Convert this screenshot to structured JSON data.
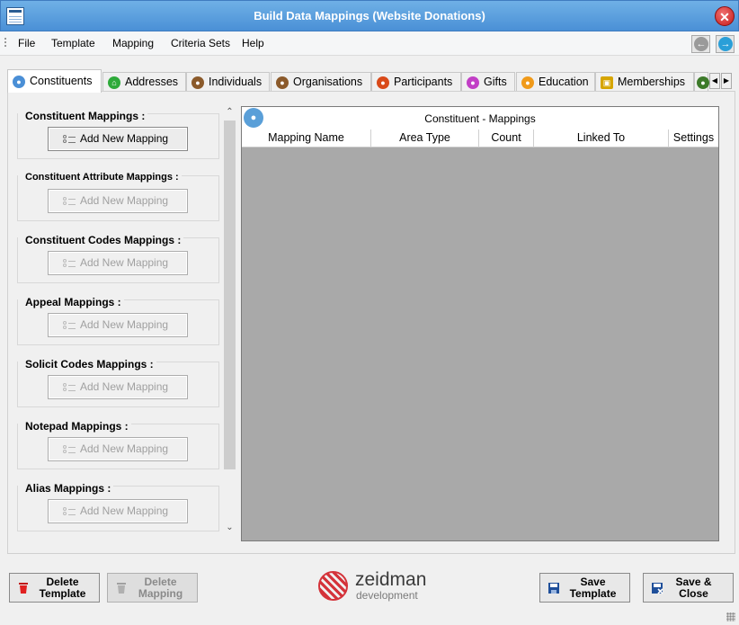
{
  "window": {
    "title": "Build Data Mappings (Website Donations)",
    "close_symbol": "✕"
  },
  "menu": {
    "items": [
      "File",
      "Template",
      "Mapping",
      "Criteria Sets",
      "Help"
    ],
    "back_icon": "back-arrow-icon",
    "forward_icon": "forward-arrow-icon"
  },
  "tabs": [
    {
      "label": "Constituents",
      "icon": "constituent-icon",
      "color": "#4a8fd6",
      "active": true
    },
    {
      "label": "Addresses",
      "icon": "house-icon",
      "color": "#2eaa3a"
    },
    {
      "label": "Individuals",
      "icon": "individuals-icon",
      "color": "#8b5a2b"
    },
    {
      "label": "Organisations",
      "icon": "organisation-icon",
      "color": "#8b5a2b"
    },
    {
      "label": "Participants",
      "icon": "participants-icon",
      "color": "#d94a1a"
    },
    {
      "label": "Gifts",
      "icon": "gift-icon",
      "color": "#c23fc6"
    },
    {
      "label": "Education",
      "icon": "education-icon",
      "color": "#f09a1a"
    },
    {
      "label": "Memberships",
      "icon": "padlock-icon",
      "color": "#d6a500"
    }
  ],
  "groups": [
    {
      "label": "Constituent Mappings :",
      "button": "Add New Mapping",
      "enabled": true
    },
    {
      "label": "Constituent Attribute Mappings :",
      "button": "Add New Mapping",
      "enabled": false
    },
    {
      "label": "Constituent Codes Mappings :",
      "button": "Add New Mapping",
      "enabled": false
    },
    {
      "label": "Appeal Mappings :",
      "button": "Add New Mapping",
      "enabled": false
    },
    {
      "label": "Solicit Codes Mappings :",
      "button": "Add New Mapping",
      "enabled": false
    },
    {
      "label": "Notepad Mappings :",
      "button": "Add New Mapping",
      "enabled": false
    },
    {
      "label": "Alias Mappings :",
      "button": "Add New Mapping",
      "enabled": false
    }
  ],
  "grid": {
    "title": "Constituent - Mappings",
    "columns": [
      "Mapping Name",
      "Area Type",
      "Count",
      "Linked To",
      "Settings"
    ]
  },
  "footer": {
    "delete_template": [
      "Delete",
      "Template"
    ],
    "delete_mapping": [
      "Delete",
      "Mapping"
    ],
    "save_template": [
      "Save",
      "Template"
    ],
    "save_close": [
      "Save &",
      "Close"
    ],
    "logo_name": "zeidman",
    "logo_sub": "development",
    "accent": "#d4333a"
  }
}
